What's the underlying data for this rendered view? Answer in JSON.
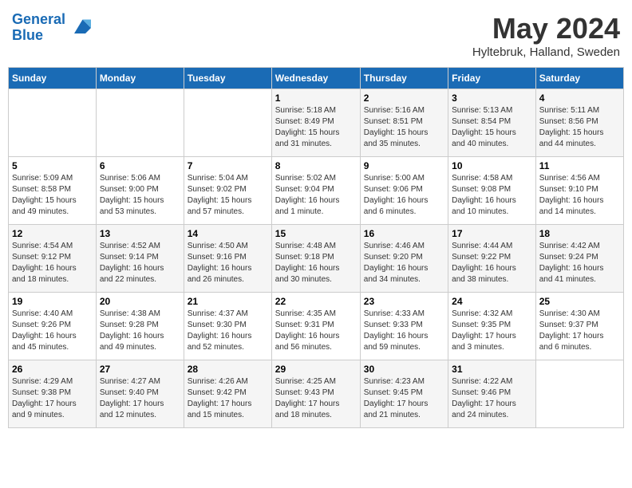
{
  "header": {
    "logo_line1": "General",
    "logo_line2": "Blue",
    "month_title": "May 2024",
    "location": "Hyltebruk, Halland, Sweden"
  },
  "days_of_week": [
    "Sunday",
    "Monday",
    "Tuesday",
    "Wednesday",
    "Thursday",
    "Friday",
    "Saturday"
  ],
  "weeks": [
    [
      {
        "num": "",
        "info": ""
      },
      {
        "num": "",
        "info": ""
      },
      {
        "num": "",
        "info": ""
      },
      {
        "num": "1",
        "info": "Sunrise: 5:18 AM\nSunset: 8:49 PM\nDaylight: 15 hours\nand 31 minutes."
      },
      {
        "num": "2",
        "info": "Sunrise: 5:16 AM\nSunset: 8:51 PM\nDaylight: 15 hours\nand 35 minutes."
      },
      {
        "num": "3",
        "info": "Sunrise: 5:13 AM\nSunset: 8:54 PM\nDaylight: 15 hours\nand 40 minutes."
      },
      {
        "num": "4",
        "info": "Sunrise: 5:11 AM\nSunset: 8:56 PM\nDaylight: 15 hours\nand 44 minutes."
      }
    ],
    [
      {
        "num": "5",
        "info": "Sunrise: 5:09 AM\nSunset: 8:58 PM\nDaylight: 15 hours\nand 49 minutes."
      },
      {
        "num": "6",
        "info": "Sunrise: 5:06 AM\nSunset: 9:00 PM\nDaylight: 15 hours\nand 53 minutes."
      },
      {
        "num": "7",
        "info": "Sunrise: 5:04 AM\nSunset: 9:02 PM\nDaylight: 15 hours\nand 57 minutes."
      },
      {
        "num": "8",
        "info": "Sunrise: 5:02 AM\nSunset: 9:04 PM\nDaylight: 16 hours\nand 1 minute."
      },
      {
        "num": "9",
        "info": "Sunrise: 5:00 AM\nSunset: 9:06 PM\nDaylight: 16 hours\nand 6 minutes."
      },
      {
        "num": "10",
        "info": "Sunrise: 4:58 AM\nSunset: 9:08 PM\nDaylight: 16 hours\nand 10 minutes."
      },
      {
        "num": "11",
        "info": "Sunrise: 4:56 AM\nSunset: 9:10 PM\nDaylight: 16 hours\nand 14 minutes."
      }
    ],
    [
      {
        "num": "12",
        "info": "Sunrise: 4:54 AM\nSunset: 9:12 PM\nDaylight: 16 hours\nand 18 minutes."
      },
      {
        "num": "13",
        "info": "Sunrise: 4:52 AM\nSunset: 9:14 PM\nDaylight: 16 hours\nand 22 minutes."
      },
      {
        "num": "14",
        "info": "Sunrise: 4:50 AM\nSunset: 9:16 PM\nDaylight: 16 hours\nand 26 minutes."
      },
      {
        "num": "15",
        "info": "Sunrise: 4:48 AM\nSunset: 9:18 PM\nDaylight: 16 hours\nand 30 minutes."
      },
      {
        "num": "16",
        "info": "Sunrise: 4:46 AM\nSunset: 9:20 PM\nDaylight: 16 hours\nand 34 minutes."
      },
      {
        "num": "17",
        "info": "Sunrise: 4:44 AM\nSunset: 9:22 PM\nDaylight: 16 hours\nand 38 minutes."
      },
      {
        "num": "18",
        "info": "Sunrise: 4:42 AM\nSunset: 9:24 PM\nDaylight: 16 hours\nand 41 minutes."
      }
    ],
    [
      {
        "num": "19",
        "info": "Sunrise: 4:40 AM\nSunset: 9:26 PM\nDaylight: 16 hours\nand 45 minutes."
      },
      {
        "num": "20",
        "info": "Sunrise: 4:38 AM\nSunset: 9:28 PM\nDaylight: 16 hours\nand 49 minutes."
      },
      {
        "num": "21",
        "info": "Sunrise: 4:37 AM\nSunset: 9:30 PM\nDaylight: 16 hours\nand 52 minutes."
      },
      {
        "num": "22",
        "info": "Sunrise: 4:35 AM\nSunset: 9:31 PM\nDaylight: 16 hours\nand 56 minutes."
      },
      {
        "num": "23",
        "info": "Sunrise: 4:33 AM\nSunset: 9:33 PM\nDaylight: 16 hours\nand 59 minutes."
      },
      {
        "num": "24",
        "info": "Sunrise: 4:32 AM\nSunset: 9:35 PM\nDaylight: 17 hours\nand 3 minutes."
      },
      {
        "num": "25",
        "info": "Sunrise: 4:30 AM\nSunset: 9:37 PM\nDaylight: 17 hours\nand 6 minutes."
      }
    ],
    [
      {
        "num": "26",
        "info": "Sunrise: 4:29 AM\nSunset: 9:38 PM\nDaylight: 17 hours\nand 9 minutes."
      },
      {
        "num": "27",
        "info": "Sunrise: 4:27 AM\nSunset: 9:40 PM\nDaylight: 17 hours\nand 12 minutes."
      },
      {
        "num": "28",
        "info": "Sunrise: 4:26 AM\nSunset: 9:42 PM\nDaylight: 17 hours\nand 15 minutes."
      },
      {
        "num": "29",
        "info": "Sunrise: 4:25 AM\nSunset: 9:43 PM\nDaylight: 17 hours\nand 18 minutes."
      },
      {
        "num": "30",
        "info": "Sunrise: 4:23 AM\nSunset: 9:45 PM\nDaylight: 17 hours\nand 21 minutes."
      },
      {
        "num": "31",
        "info": "Sunrise: 4:22 AM\nSunset: 9:46 PM\nDaylight: 17 hours\nand 24 minutes."
      },
      {
        "num": "",
        "info": ""
      }
    ]
  ]
}
